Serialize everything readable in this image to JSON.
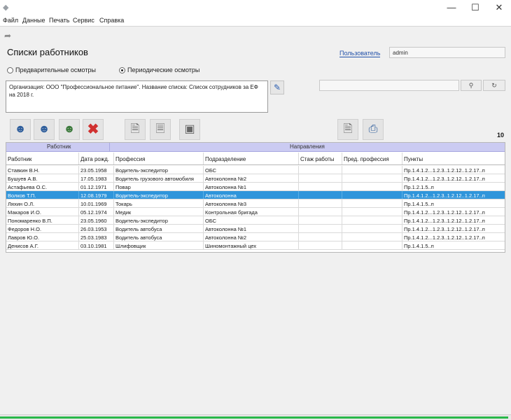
{
  "window": {
    "app_icon": "app-icon",
    "minimize": "—",
    "maximize": "☐",
    "close": "✕"
  },
  "menu": [
    "Файл",
    "Данные",
    "Печать",
    "Сервис",
    "Справка"
  ],
  "page_title": "Списки работников",
  "user": {
    "label": "Пользователь",
    "value": "admin"
  },
  "exam_type": {
    "options": [
      "Предварительные осмотры",
      "Периодические осмотры"
    ],
    "selected": 1
  },
  "org_text": "Организация: ООО \"Профессиональное питание\". Название списка: Список сотрудников за ЕФ на 2018 г.",
  "search": {
    "value": ""
  },
  "toolbar": {
    "icons": [
      "add-user-icon",
      "edit-user-icon",
      "user-settings-icon",
      "delete-icon",
      "document-edit-icon",
      "document-copy-icon",
      "trash-icon",
      "print-preview-icon",
      "print-icon"
    ]
  },
  "count": "10",
  "grid": {
    "groups": [
      "Работник",
      "Направления"
    ],
    "columns": [
      "Работник",
      "Дата рожд.",
      "Профессия",
      "Подразделение",
      "Стаж работы",
      "Пред. профессия",
      "Пункты"
    ],
    "rows": [
      [
        "Ставкин В.Н.",
        "23.05.1958",
        "Водитель-экспедитор",
        "ОБС",
        "",
        "",
        "Пр.1.4.1.2...1.2.3..1.2.12..1.2.17..п"
      ],
      [
        "Бушуев А.В.",
        "17.05.1983",
        "Водитель грузового автомобиля",
        "Автоколонна №2",
        "",
        "",
        "Пр.1.4.1.2...1.2.3..1.2.12..1.2.17..п"
      ],
      [
        "Астафьева О.С.",
        "01.12.1971",
        "Повар",
        "Автоколонна №1",
        "",
        "",
        "Пр.1.2.1.5..п"
      ],
      [
        "Волков Т.П.",
        "12.08.1979",
        "Водитель-экспедитор",
        "Автоколонна",
        "",
        "",
        "Пр.1.4.1.2...1.2.3..1.2.12..1.2.17..п"
      ],
      [
        "Ляхин О.Л.",
        "10.01.1969",
        "Токарь",
        "Автоколонна №3",
        "",
        "",
        "Пр.1.4.1.5..п"
      ],
      [
        "Макаров И.О.",
        "05.12.1974",
        "Медик",
        "Контрольная бригада",
        "",
        "",
        "Пр.1.4.1.2...1.2.3..1.2.12..1.2.17..п"
      ],
      [
        "Пономаренко В.П.",
        "23.05.1960",
        "Водитель-экспедитор",
        "ОБС",
        "",
        "",
        "Пр.1.4.1.2...1.2.3..1.2.12..1.2.17..п"
      ],
      [
        "Федоров Н.О.",
        "26.03.1953",
        "Водитель автобуса",
        "Автоколонна №1",
        "",
        "",
        "Пр.1.4.1.2...1.2.3..1.2.12..1.2.17..п"
      ],
      [
        "Лавров Ю.О.",
        "25.03.1983",
        "Водитель автобуса",
        "Автоколонна №2",
        "",
        "",
        "Пр.1.4.1.2...1.2.3..1.2.12..1.2.17..п"
      ],
      [
        "Денисов А.Г.",
        "03.10.1981",
        "Шлифовщик",
        "Шиномонтажный цех",
        "",
        "",
        "Пр.1.4.1.5..п"
      ]
    ],
    "selected_row": 3
  },
  "colors": {
    "selection": "#2f95db",
    "group_header": "#cbcbf2",
    "progress": "#29b84a",
    "link": "#1f4fa8"
  }
}
